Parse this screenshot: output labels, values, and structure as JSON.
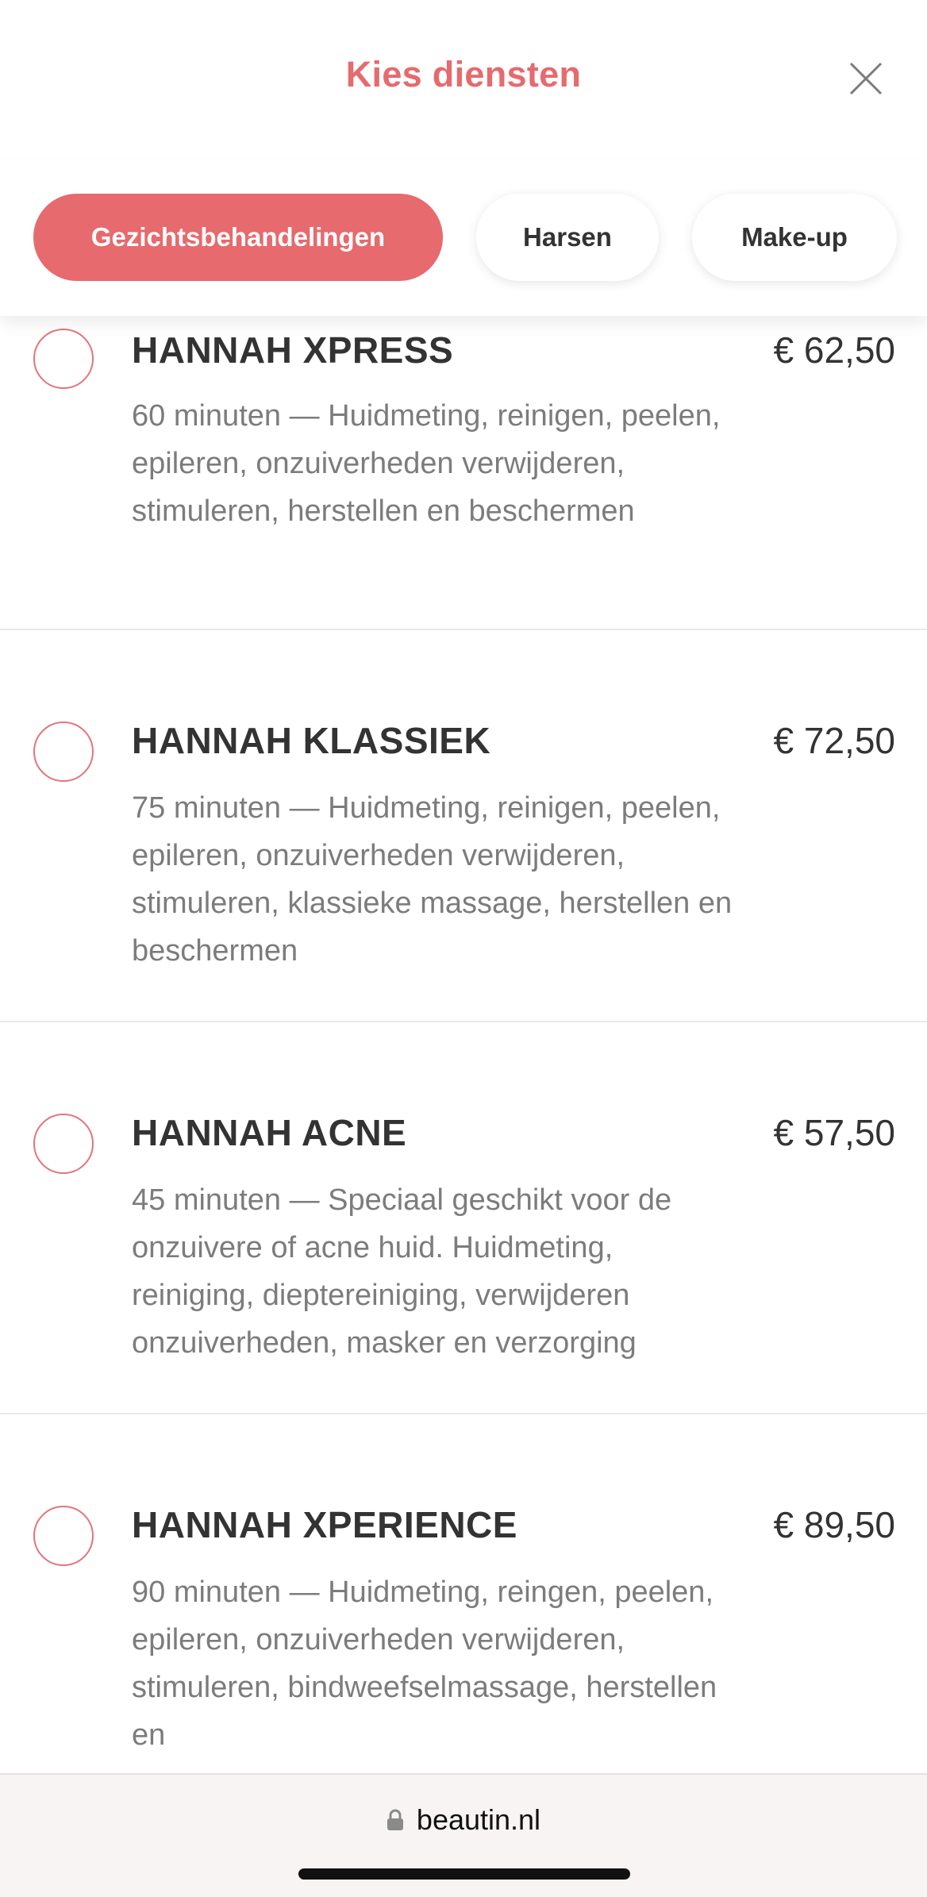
{
  "header": {
    "title": "Kies diensten"
  },
  "tabs": [
    {
      "label": "Gezichtsbehandelingen",
      "active": true
    },
    {
      "label": "Harsen",
      "active": false
    },
    {
      "label": "Make-up",
      "active": false
    }
  ],
  "services": [
    {
      "name": "HANNAH XPRESS",
      "price": "€ 62,50",
      "description": "60 minuten — Huidmeting, reinigen, peelen, epileren, onzuiverheden verwijderen, stimuleren, herstellen en beschermen"
    },
    {
      "name": "HANNAH KLASSIEK",
      "price": "€ 72,50",
      "description": "75 minuten — Huidmeting, reinigen, peelen, epileren, onzuiverheden verwijderen, stimuleren, klassieke massage, herstellen en beschermen"
    },
    {
      "name": "HANNAH ACNE",
      "price": "€ 57,50",
      "description": "45 minuten — Speciaal geschikt voor de onzuivere of acne huid. Huidmeting, reiniging, dieptereiniging, verwijderen onzuiverheden, masker en verzorging"
    },
    {
      "name": "HANNAH XPERIENCE",
      "price": "€ 89,50",
      "description": "90 minuten — Huidmeting, reingen, peelen, epileren, onzuiverheden verwijderen, stimuleren, bindweefselmassage, herstellen en"
    }
  ],
  "browser": {
    "url": "beautin.nl"
  },
  "colors": {
    "accent": "#e66a6e",
    "text": "#333333",
    "muted": "#7c7c7c"
  },
  "icons": {
    "close": "close-icon",
    "lock": "lock-icon"
  }
}
